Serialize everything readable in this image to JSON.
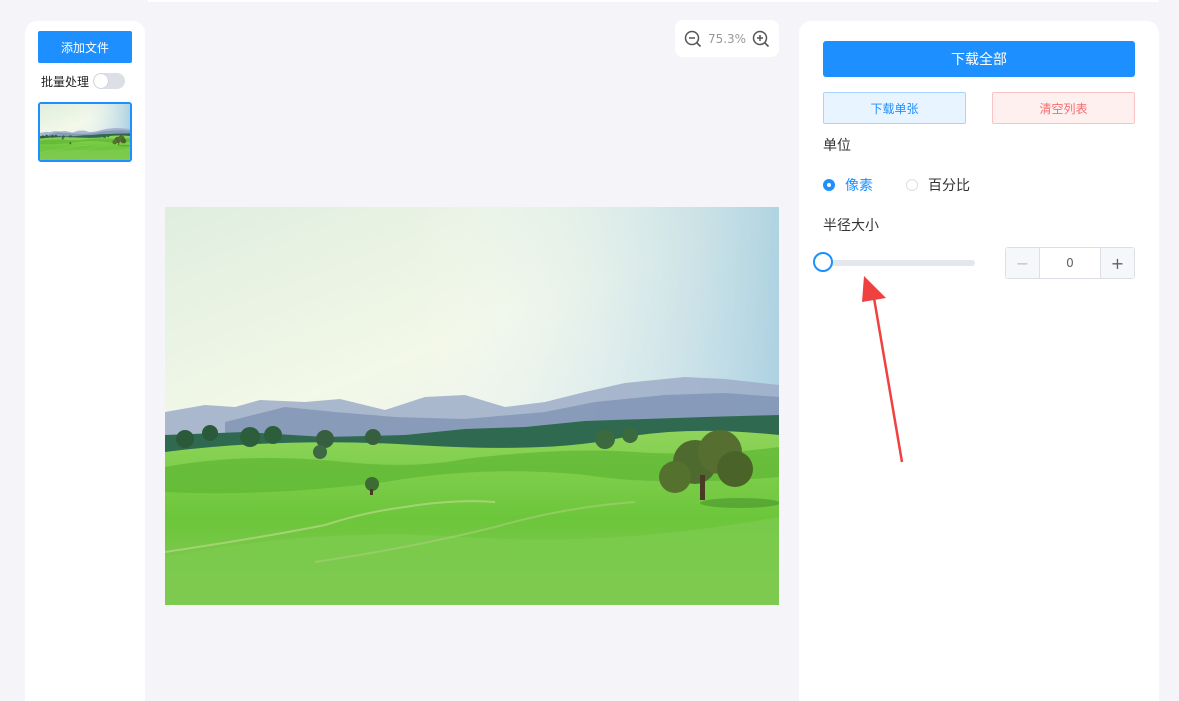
{
  "sidebar": {
    "add_file_label": "添加文件",
    "batch_label": "批量处理",
    "batch_enabled": false
  },
  "zoom": {
    "value": "75.3%"
  },
  "panel": {
    "download_all": "下载全部",
    "download_one": "下载单张",
    "clear_list": "清空列表",
    "unit_label": "单位",
    "unit_options": [
      "像素",
      "百分比"
    ],
    "unit_selected": "像素",
    "radius_label": "半径大小",
    "radius_value": "0",
    "slider_fraction": 0
  },
  "icons": {
    "zoom_out": "zoom-out-icon",
    "zoom_in": "zoom-in-icon",
    "minus": "minus-icon",
    "plus": "plus-icon"
  },
  "colors": {
    "primary": "#1e8fff",
    "danger": "#f56c6c",
    "annotation": "#f04040"
  }
}
